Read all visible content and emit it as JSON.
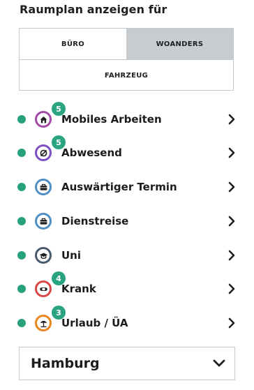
{
  "title": "Raumplan anzeigen für",
  "segments": {
    "office": "BÜRO",
    "elsewhere": "WOANDERS",
    "vehicle": "FAHRZEUG"
  },
  "items": [
    {
      "label": "Mobiles Arbeiten",
      "badge": "5",
      "icon": "home-icon",
      "color": "#a24aa6"
    },
    {
      "label": "Abwesend",
      "badge": "5",
      "icon": "absent-icon",
      "color": "#7d4fc4"
    },
    {
      "label": "Auswärtiger Termin",
      "badge": "",
      "icon": "briefcase-icon",
      "color": "#4f8fc4"
    },
    {
      "label": "Dienstreise",
      "badge": "",
      "icon": "briefcase-icon",
      "color": "#4f8fc4"
    },
    {
      "label": "Uni",
      "badge": "",
      "icon": "graduation-cap-icon",
      "color": "#4a5a6e"
    },
    {
      "label": "Krank",
      "badge": "4",
      "icon": "bandage-icon",
      "color": "#d94848"
    },
    {
      "label": "Urlaub / ÜA",
      "badge": "3",
      "icon": "beach-umbrella-icon",
      "color": "#e9861d"
    }
  ],
  "location_select": {
    "value": "Hamburg"
  },
  "colors": {
    "status_dot": "#27a27d",
    "badge": "#2aa381",
    "active_segment": "#c7ccd1"
  }
}
